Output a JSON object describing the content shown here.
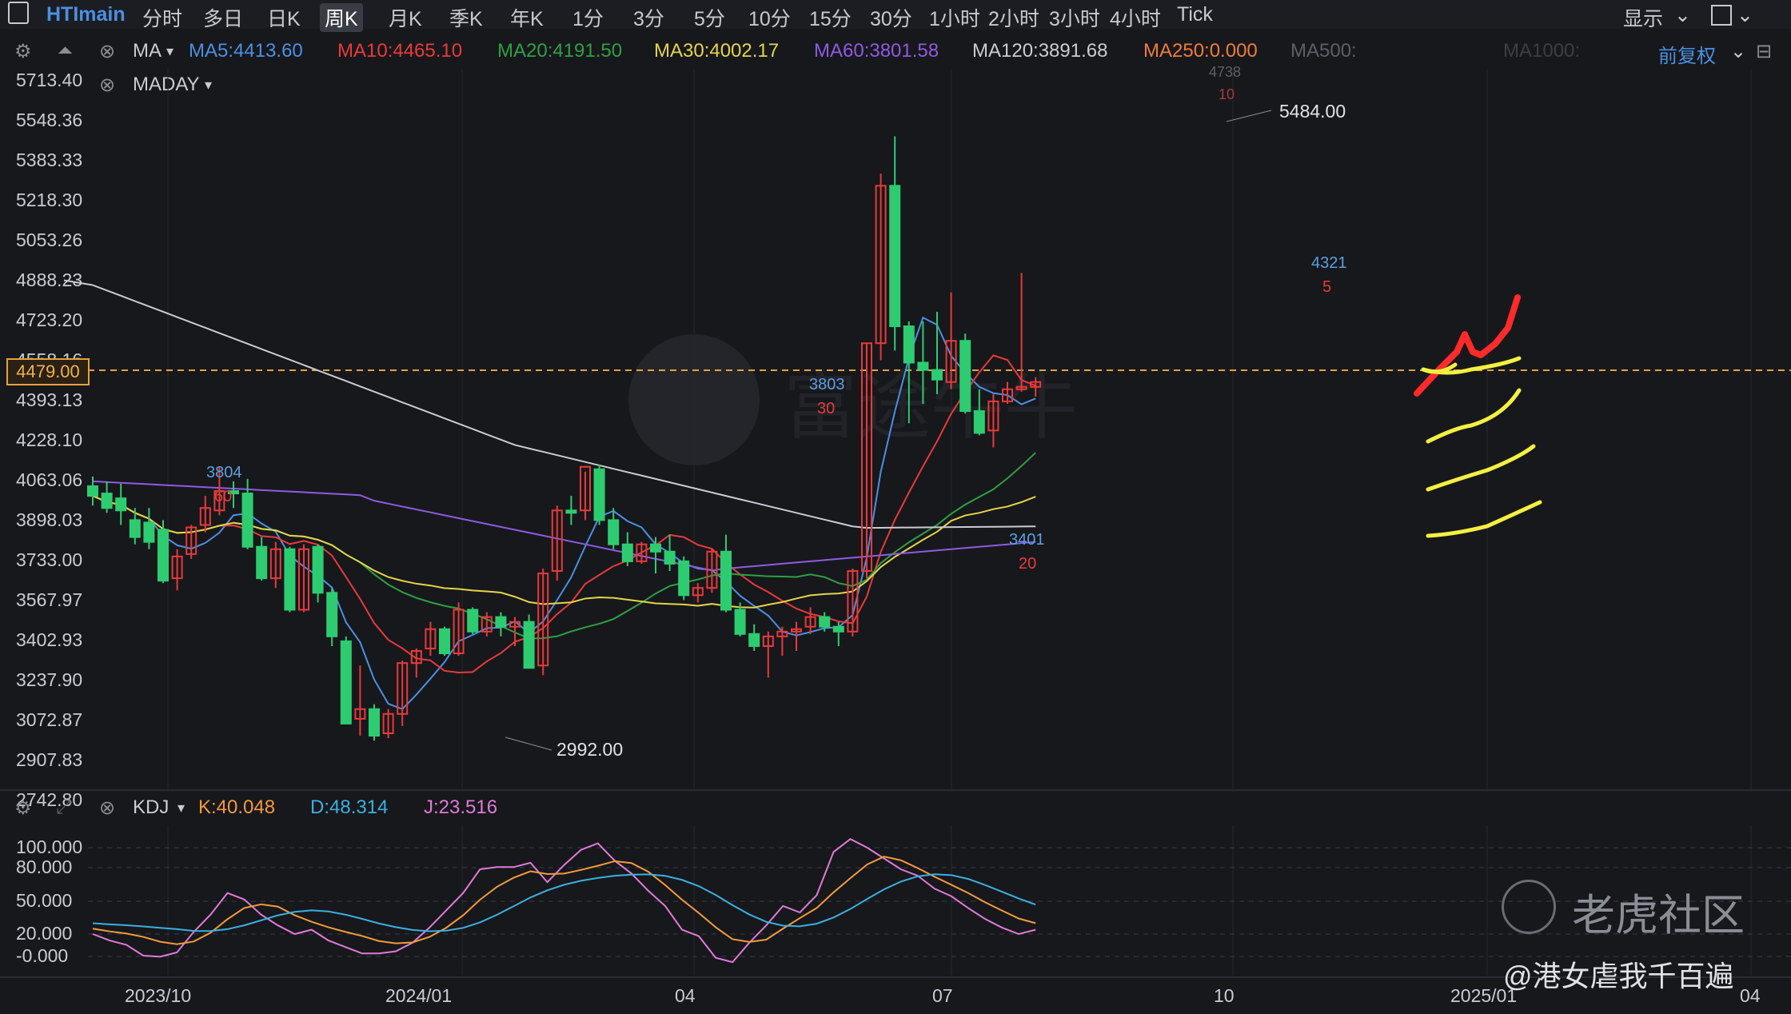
{
  "topbar": {
    "symbol": "HTImain",
    "tabs": [
      "分时",
      "多日",
      "日K",
      "周K",
      "月K",
      "季K",
      "年K",
      "1分",
      "3分",
      "5分",
      "10分",
      "15分",
      "30分",
      "1小时",
      "2小时",
      "3小时",
      "4小时",
      "Tick"
    ],
    "selected_tab": "周K",
    "display_label": "显示"
  },
  "ma_bar": {
    "indicator": "MA",
    "second_indicator": "MADAY",
    "items": [
      {
        "label": "MA5:4413.60",
        "color": "#4a90e2"
      },
      {
        "label": "MA10:4465.10",
        "color": "#e83a3a"
      },
      {
        "label": "MA20:4191.50",
        "color": "#2ea043"
      },
      {
        "label": "MA30:4002.17",
        "color": "#e6d44a"
      },
      {
        "label": "MA60:3801.58",
        "color": "#8e5be0"
      },
      {
        "label": "MA120:3891.68",
        "color": "#c9ccd2"
      },
      {
        "label": "MA250:0.000",
        "color": "#f07c3a"
      },
      {
        "label": "MA500:",
        "color": "#5a6068"
      },
      {
        "label": "MA1000:",
        "color": "#3a3f46"
      }
    ],
    "adjust_label": "前复权"
  },
  "price_axis": [
    "5713.40",
    "5548.36",
    "5383.33",
    "5218.30",
    "5053.26",
    "4888.23",
    "4723.20",
    "4558.16",
    "4393.13",
    "4228.10",
    "4063.06",
    "3898.03",
    "3733.00",
    "3567.97",
    "3402.93",
    "3237.90",
    "3072.87",
    "2907.83",
    "2742.80"
  ],
  "current_price": "4479.00",
  "annotations": {
    "high_label": "5484.00",
    "low_label": "2992.00",
    "peak_4738": "4738",
    "peak_10": "10",
    "mark_3804": "3804",
    "mark_60": "60",
    "mark_3803": "3803",
    "mark_30": "30",
    "mark_3401": "3401",
    "mark_20": "20",
    "mark_4321": "4321",
    "mark_5": "5"
  },
  "kdj": {
    "name": "KDJ",
    "k": "K:40.048",
    "d": "D:48.314",
    "j": "J:23.516",
    "axis": [
      "100.000",
      "80.000",
      "50.000",
      "20.000",
      "-0.000"
    ]
  },
  "x_axis": [
    "2023/10",
    "2024/01",
    "04",
    "07",
    "10",
    "2025/01",
    "04"
  ],
  "watermark": {
    "community": "老虎社区",
    "author": "@港女虐我千百遍",
    "brand": "富途牛牛"
  },
  "colors": {
    "up": "#e83a3a",
    "down": "#2ecc71",
    "bg": "#17181c"
  }
}
